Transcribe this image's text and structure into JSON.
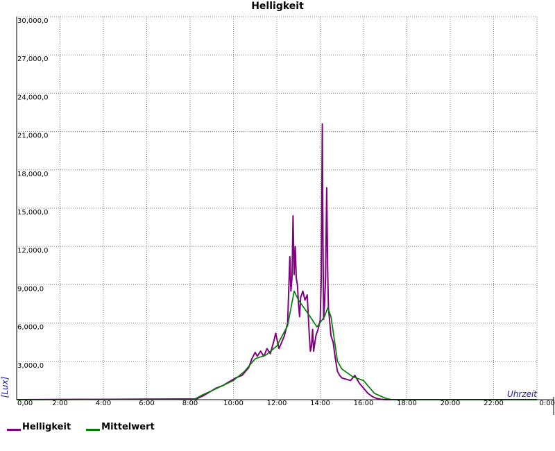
{
  "chart_data": {
    "type": "line",
    "title": "Helligkeit",
    "xlabel": "Uhrzeit",
    "ylabel": "[Lux]",
    "xlim": [
      0,
      24
    ],
    "ylim": [
      0,
      30000
    ],
    "grid": true,
    "legend_position": "bottom-left",
    "x_ticks": [
      {
        "value": 0,
        "label": "0,00"
      },
      {
        "value": 2,
        "label": "2:00"
      },
      {
        "value": 4,
        "label": "4:00"
      },
      {
        "value": 6,
        "label": "6:00"
      },
      {
        "value": 8,
        "label": "8:00"
      },
      {
        "value": 10,
        "label": "10:00"
      },
      {
        "value": 12,
        "label": "12:00"
      },
      {
        "value": 14,
        "label": "14:00"
      },
      {
        "value": 16,
        "label": "16:00"
      },
      {
        "value": 18,
        "label": "18:00"
      },
      {
        "value": 20,
        "label": "20:00"
      },
      {
        "value": 22,
        "label": "22:00"
      },
      {
        "value": 24,
        "label": "0:00"
      }
    ],
    "y_ticks": [
      {
        "value": 3000,
        "label": "3,000,0"
      },
      {
        "value": 6000,
        "label": "6,000,0"
      },
      {
        "value": 9000,
        "label": "9,000,0"
      },
      {
        "value": 12000,
        "label": "12,000,0"
      },
      {
        "value": 15000,
        "label": "15,000,0"
      },
      {
        "value": 18000,
        "label": "18,000,0"
      },
      {
        "value": 21000,
        "label": "21,000,0"
      },
      {
        "value": 24000,
        "label": "24,000,0"
      },
      {
        "value": 27000,
        "label": "27,000,0"
      },
      {
        "value": 30000,
        "label": "30,000,0"
      }
    ],
    "series": [
      {
        "name": "Helligkeit",
        "color": "#800080",
        "x": [
          0,
          8.3,
          8.6,
          8.9,
          9.2,
          9.5,
          9.8,
          10.1,
          10.4,
          10.7,
          10.85,
          11.0,
          11.1,
          11.25,
          11.4,
          11.55,
          11.7,
          11.85,
          11.95,
          12.1,
          12.2,
          12.35,
          12.5,
          12.6,
          12.65,
          12.7,
          12.75,
          12.8,
          12.85,
          12.9,
          12.95,
          13.0,
          13.05,
          13.1,
          13.2,
          13.3,
          13.4,
          13.5,
          13.55,
          13.6,
          13.65,
          13.7,
          13.8,
          13.9,
          14.0,
          14.05,
          14.1,
          14.13,
          14.16,
          14.2,
          14.25,
          14.3,
          14.35,
          14.38,
          14.42,
          14.5,
          14.6,
          14.7,
          14.8,
          14.9,
          15.0,
          15.2,
          15.4,
          15.6,
          15.8,
          16.0,
          16.2,
          16.4,
          16.6,
          16.8,
          17.0,
          17.2,
          17.5,
          24
        ],
        "y": [
          0,
          60,
          300,
          600,
          900,
          1100,
          1400,
          1700,
          1900,
          2500,
          3200,
          3700,
          3400,
          3800,
          3400,
          4000,
          3600,
          4500,
          5200,
          4000,
          4400,
          5000,
          6000,
          11200,
          8500,
          9500,
          14400,
          9800,
          12000,
          9500,
          9000,
          7500,
          6500,
          8000,
          8500,
          7800,
          8200,
          5000,
          3800,
          4200,
          5500,
          3800,
          5000,
          5500,
          6200,
          9500,
          21600,
          12000,
          6300,
          7500,
          9500,
          16600,
          10000,
          7200,
          6500,
          5000,
          4500,
          3200,
          2200,
          1900,
          1700,
          1600,
          1500,
          1900,
          1300,
          900,
          500,
          250,
          100,
          30,
          0,
          0,
          0,
          0
        ]
      },
      {
        "name": "Mittelwert",
        "color": "#008000",
        "x": [
          0,
          8.2,
          8.6,
          9.0,
          9.5,
          10.0,
          10.5,
          11.0,
          11.5,
          12.0,
          12.5,
          12.8,
          13.0,
          13.5,
          13.85,
          14.2,
          14.35,
          14.5,
          14.8,
          15.0,
          15.5,
          16.0,
          16.5,
          17.0,
          17.3,
          24
        ],
        "y": [
          0,
          30,
          400,
          700,
          1100,
          1500,
          2200,
          3200,
          3500,
          4200,
          5800,
          8500,
          7800,
          6600,
          5700,
          6500,
          7200,
          6500,
          3000,
          2400,
          1800,
          1500,
          500,
          120,
          0,
          0
        ]
      }
    ]
  }
}
